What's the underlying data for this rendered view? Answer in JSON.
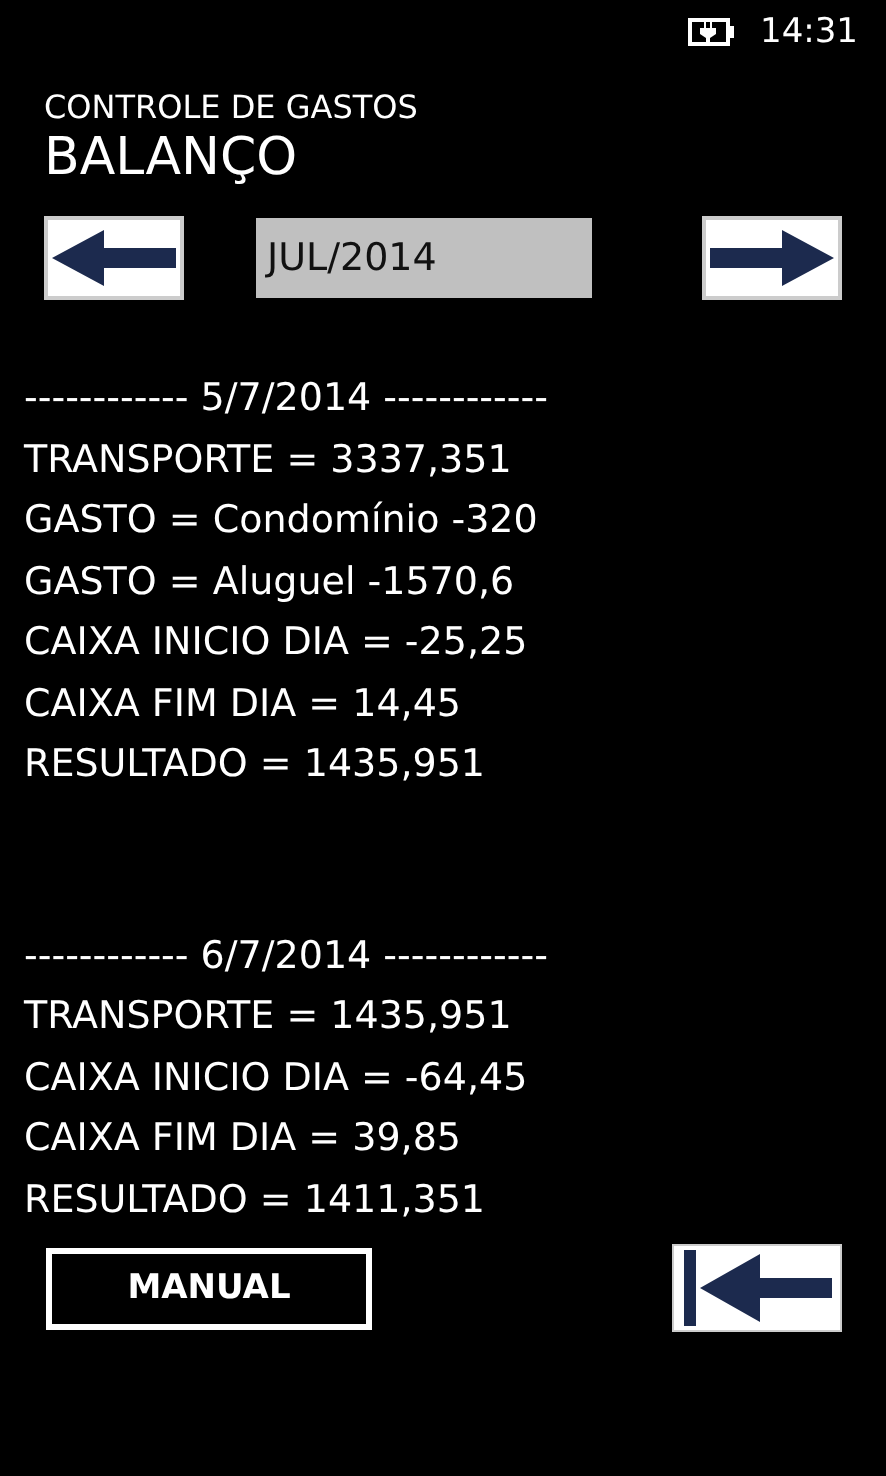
{
  "status_bar": {
    "time": "14:31"
  },
  "header": {
    "app_title": "CONTROLE DE GASTOS",
    "page_title": "BALANÇO"
  },
  "month_selector": {
    "value": "JUL/2014"
  },
  "days": [
    {
      "header": "------------ 5/7/2014 ------------",
      "lines": [
        "TRANSPORTE = 3337,351",
        "GASTO = Condomínio -320",
        "GASTO = Aluguel -1570,6",
        "CAIXA INICIO DIA = -25,25",
        "CAIXA FIM DIA = 14,45",
        "RESULTADO = 1435,951"
      ]
    },
    {
      "header": "------------ 6/7/2014 ------------",
      "lines": [
        "TRANSPORTE = 1435,951",
        "CAIXA INICIO DIA = -64,45",
        "CAIXA FIM DIA = 39,85",
        "RESULTADO = 1411,351"
      ]
    }
  ],
  "footer": {
    "manual_button": "MANUAL"
  }
}
